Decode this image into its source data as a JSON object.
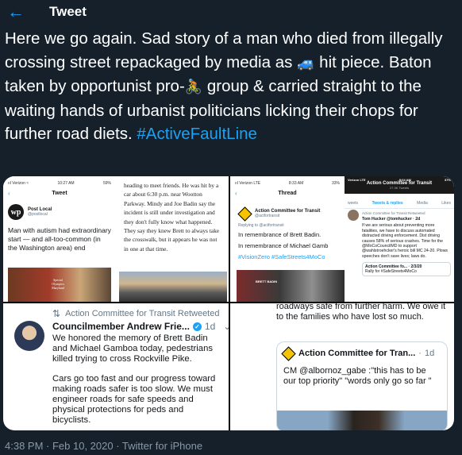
{
  "header": {
    "title": "Tweet",
    "back_icon": "arrow-left-icon"
  },
  "tweet": {
    "text_1": "Here we go again. Sad story of a man who died from illegally crossing street repackaged by media as ",
    "emoji_car": "🚙",
    "text_2": " hit piece. Baton taken by opportunist pro-",
    "emoji_cyclist": "🚴",
    "text_3": " group & carried straight to the waiting hands of urbanist politicians licking their chops for further road diets. ",
    "hashtag": "#ActiveFaultLine"
  },
  "media": {
    "screenshot_1": {
      "status_left": "ııl Verizon ≈",
      "status_time": "10:27 AM",
      "status_right": "59%",
      "title": "Tweet",
      "account_name": "Post Local",
      "account_handle": "@postlocal",
      "logo_text": "wp",
      "post_text": "Man with autism had extraordinary start — and all-too-common (in the Washington area) end",
      "sign_text": "Special Olympics Maryland",
      "article_text": "heading to meet friends. He was hit by a car about 6:30 p.m. near Wootton Parkway. Mindy and Joe Badin say the incident is still under investigation and they don't fully know what happened. They say they knew Brett to always take the crosswalk, but it appears he was not in one at that time."
    },
    "screenshot_2": {
      "status_left": "ııl Verizon LTE",
      "status_time": "8:33 AM",
      "status_right": "33%",
      "title": "Thread",
      "account_name": "Action Committee for Transit",
      "account_handle": "@actfortransit",
      "replying": "Replying to @actfortransit",
      "line_1": "In remembrance of Brett Badin.",
      "line_2": "In remembrance of Michael Gamb",
      "hashtags": "#VisionZero #SafeStreets4MoCo",
      "photo_caption": "BRETT BADIN",
      "profile_status_left": "Verizon LTE",
      "profile_status_time": "8:04 AM",
      "profile_status_right": "37%",
      "profile_title": "Action Committee for Transit",
      "profile_subtitle": "27.3K Tweets",
      "tabs": [
        "weets",
        "Tweets & replies",
        "Media",
        "Likes"
      ],
      "rt_line": "Action Committee for Transit Retweeted",
      "rt_author": "Tom Hucker @tomhucker · 2d",
      "rt_text": "If we are serious about preventing more fatalities, we have to discuss automated distracted driving enforcement. Dist driving causes 58% of serious crashes. Time for the @MoCoCouncilMD to support @wahlstroehcker's heroic bill MC 24-20. Plows speeches don't save lives; laws do.",
      "quote_name": "Action Committee fo... · 2/3/20",
      "quote_text": "Rally for #SafeStreets4MoCo"
    },
    "retweet": {
      "rt_label": "Action Committee for Transit Retweeted",
      "author": "Councilmember Andrew Frie...",
      "time": "1d",
      "para_1": "We honored the memory of Brett Badin and Michael Gamboa today, pedestrians killed trying to cross Rockville Pike.",
      "para_2": "Cars go too fast and our progress toward making roads safer is too slow. We must engineer roads for safe speeds and physical protections for peds and bicyclists."
    },
    "continuation": {
      "text": "roadways safe from further harm. We owe it to the families who have lost so much.",
      "quote_name": "Action Committee for Tran...",
      "quote_time": "1d",
      "quote_text": "CM @albornoz_gabe :\"this has to be our top priority\" \"words only go so far \""
    }
  },
  "footer": {
    "meta": "4:38 PM · Feb 10, 2020 · Twitter for iPhone"
  },
  "colors": {
    "background": "#15202b",
    "accent": "#1da1f2",
    "muted": "#8899a6"
  }
}
